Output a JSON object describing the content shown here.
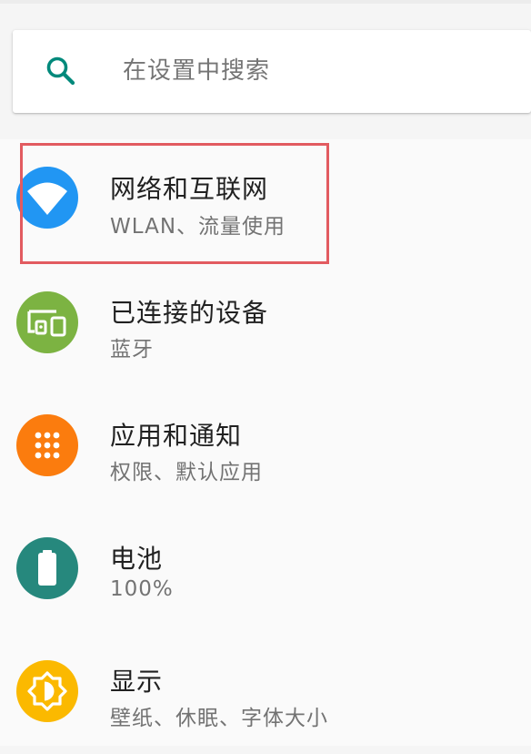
{
  "search": {
    "placeholder": "在设置中搜索"
  },
  "settings": [
    {
      "id": "network",
      "title": "网络和互联网",
      "subtitle": "WLAN、流量使用",
      "icon": "wifi-icon",
      "color": "#2196f3"
    },
    {
      "id": "devices",
      "title": "已连接的设备",
      "subtitle": "蓝牙",
      "icon": "devices-icon",
      "color": "#7cb342"
    },
    {
      "id": "apps",
      "title": "应用和通知",
      "subtitle": "权限、默认应用",
      "icon": "apps-grid-icon",
      "color": "#fb7c0e"
    },
    {
      "id": "battery",
      "title": "电池",
      "subtitle": "100%",
      "icon": "battery-icon",
      "color": "#26887d"
    },
    {
      "id": "display",
      "title": "显示",
      "subtitle": "壁纸、休眠、字体大小",
      "icon": "brightness-icon",
      "color": "#fbb900"
    }
  ],
  "colors": {
    "accent": "#00897b",
    "highlight": "#e25b60"
  }
}
